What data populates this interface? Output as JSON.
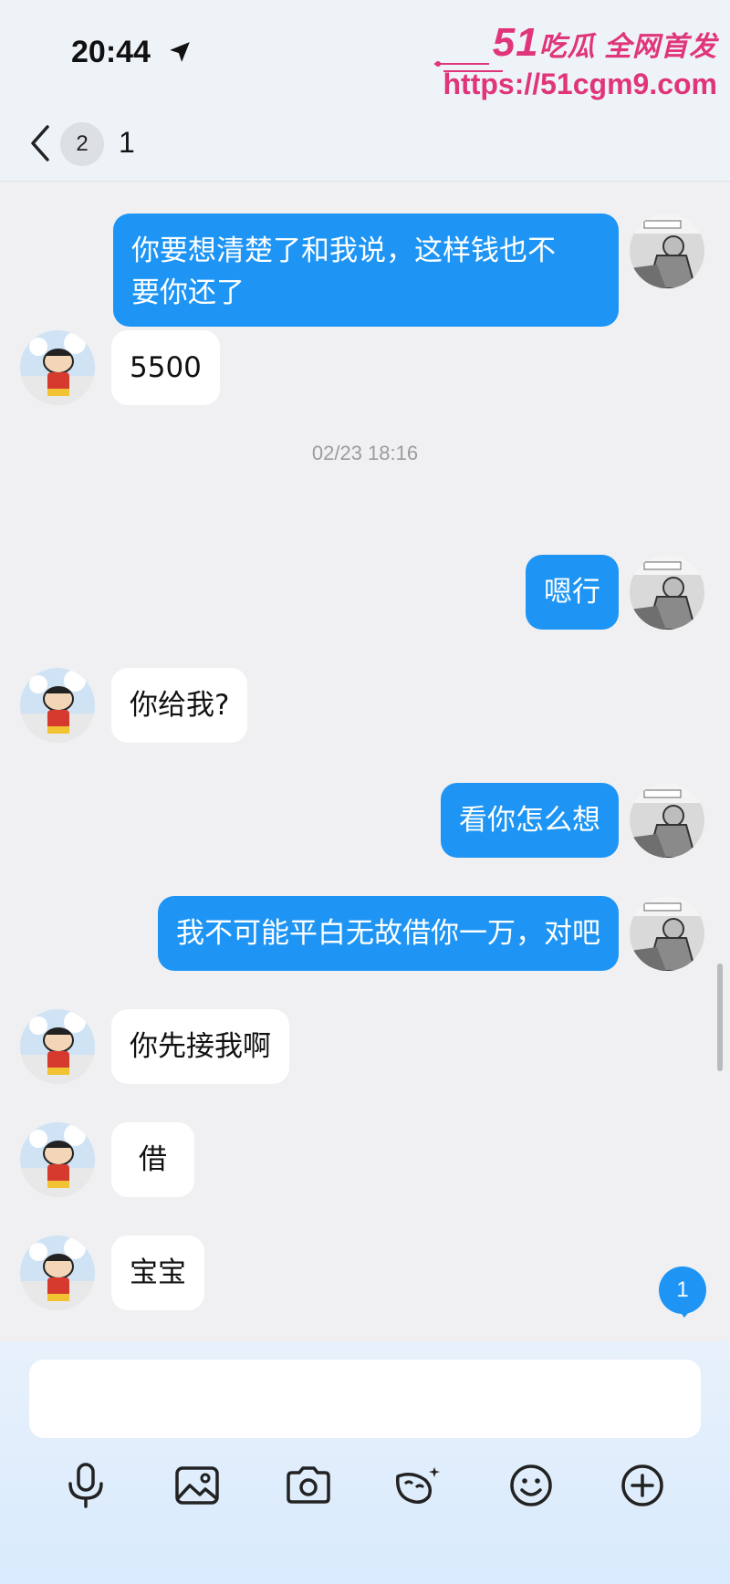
{
  "status_bar": {
    "time": "20:44"
  },
  "watermark": {
    "brand_big": "51",
    "brand_text": "吃瓜 全网首发",
    "url": "https://51cgm9.com"
  },
  "nav": {
    "unread_count": "2",
    "title": "1"
  },
  "messages": [
    {
      "side": "out",
      "text_lines": [
        "你要想清楚了和我说，这样钱也不",
        "要你还了"
      ]
    },
    {
      "side": "in",
      "text": "5500"
    },
    {
      "timestamp": "02/23 18:16"
    },
    {
      "side": "out",
      "text": "嗯行"
    },
    {
      "side": "in",
      "text": "你给我?"
    },
    {
      "side": "out",
      "text": "看你怎么想"
    },
    {
      "side": "out",
      "text": "我不可能平白无故借你一万，对吧"
    },
    {
      "side": "in",
      "text": "你先接我啊"
    },
    {
      "side": "in",
      "text": "借"
    },
    {
      "side": "in",
      "text": "宝宝"
    }
  ],
  "new_message_badge": "1",
  "input": {
    "placeholder": ""
  },
  "toolbar": {
    "icons": [
      "microphone-icon",
      "image-icon",
      "camera-icon",
      "sticker-icon",
      "emoji-icon",
      "plus-icon"
    ]
  },
  "colors": {
    "outgoing_bubble": "#1e95f5",
    "incoming_bubble": "#ffffff",
    "background": "#f0f0f2",
    "watermark": "#e0357a"
  }
}
